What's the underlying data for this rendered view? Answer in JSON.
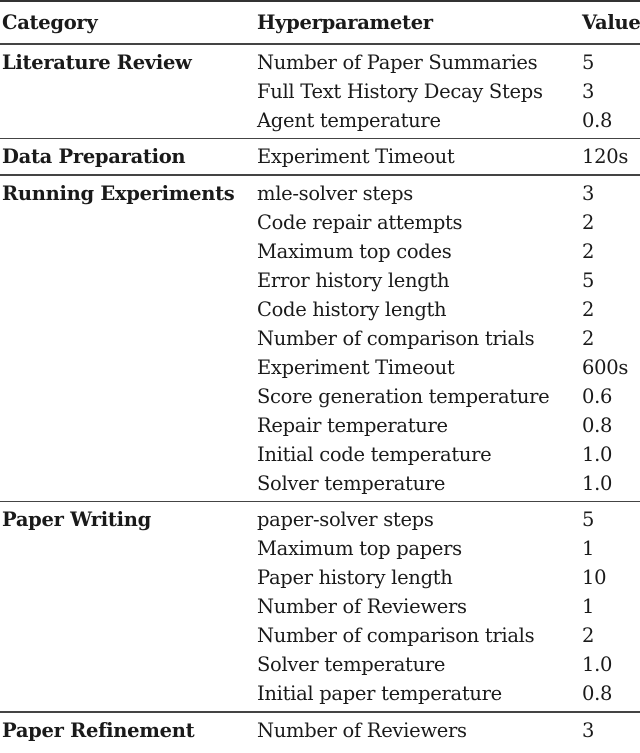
{
  "table": {
    "headers": {
      "category": "Category",
      "hyperparameter": "Hyperparameter",
      "value": "Value"
    },
    "groups": [
      {
        "category": "Literature Review",
        "rows": [
          {
            "param": "Number of Paper Summaries",
            "value": "5"
          },
          {
            "param": "Full Text History Decay Steps",
            "value": "3"
          },
          {
            "param": "Agent temperature",
            "value": "0.8"
          }
        ]
      },
      {
        "category": "Data Preparation",
        "rows": [
          {
            "param": "Experiment Timeout",
            "value": "120s"
          }
        ]
      },
      {
        "category": "Running Experiments",
        "rows": [
          {
            "param": "mle-solver steps",
            "value": "3"
          },
          {
            "param": "Code repair attempts",
            "value": "2"
          },
          {
            "param": "Maximum top codes",
            "value": "2"
          },
          {
            "param": "Error history length",
            "value": "5"
          },
          {
            "param": "Code history length",
            "value": "2"
          },
          {
            "param": "Number of comparison trials",
            "value": "2"
          },
          {
            "param": "Experiment Timeout",
            "value": "600s"
          },
          {
            "param": "Score generation temperature",
            "value": "0.6"
          },
          {
            "param": "Repair temperature",
            "value": "0.8"
          },
          {
            "param": "Initial code temperature",
            "value": "1.0"
          },
          {
            "param": "Solver temperature",
            "value": "1.0"
          }
        ]
      },
      {
        "category": "Paper Writing",
        "rows": [
          {
            "param": "paper-solver steps",
            "value": "5"
          },
          {
            "param": "Maximum top papers",
            "value": "1"
          },
          {
            "param": "Paper history length",
            "value": "10"
          },
          {
            "param": "Number of Reviewers",
            "value": "1"
          },
          {
            "param": "Number of comparison trials",
            "value": "2"
          },
          {
            "param": "Solver temperature",
            "value": "1.0"
          },
          {
            "param": "Initial paper temperature",
            "value": "0.8"
          }
        ]
      },
      {
        "category": "Paper Refinement",
        "rows": [
          {
            "param": "Number of Reviewers",
            "value": "3"
          }
        ]
      }
    ]
  }
}
